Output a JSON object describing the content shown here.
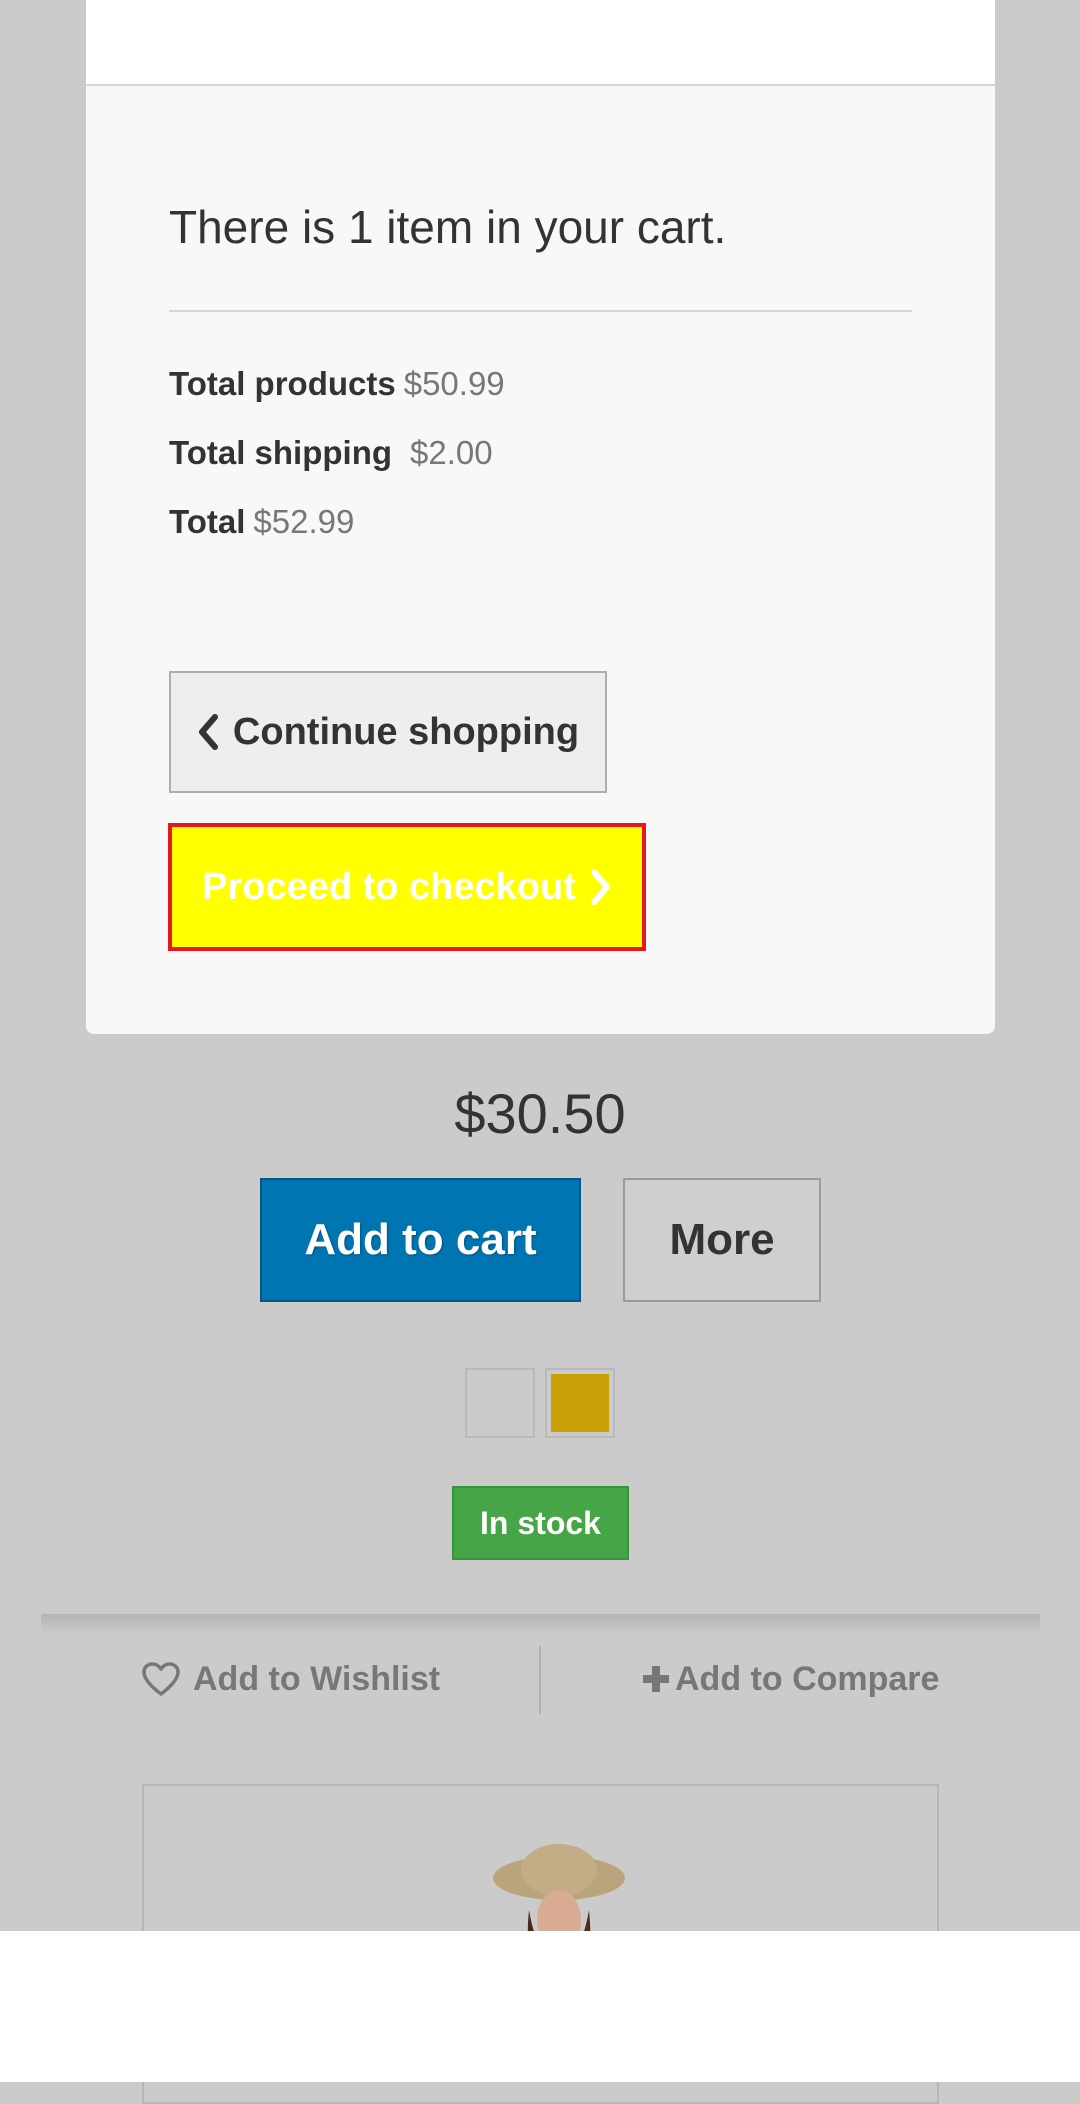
{
  "cart_popup": {
    "heading": "There is 1 item in your cart.",
    "summary": [
      {
        "label": "Total products",
        "value": "$50.99"
      },
      {
        "label": "Total shipping",
        "value": "$2.00"
      },
      {
        "label": "Total",
        "value": "$52.99"
      }
    ],
    "continue_label": "Continue shopping",
    "continue_icon": "chevron-left-icon",
    "checkout_label": "Proceed to checkout",
    "checkout_icon": "chevron-right-icon"
  },
  "product": {
    "price": "$30.50",
    "add_to_cart_label": "Add to cart",
    "more_label": "More",
    "color_swatches": [
      {
        "name": "white",
        "color": "#cbcbcb"
      },
      {
        "name": "gold",
        "color": "#c89f06"
      }
    ],
    "stock_label": "In stock",
    "wishlist_label": "Add to Wishlist",
    "wishlist_icon": "heart-icon",
    "compare_label": "Add to Compare",
    "compare_icon": "plus-icon"
  },
  "colors": {
    "checkout_bg": "#ffff00",
    "checkout_border": "#e5191c",
    "add_to_cart_bg": "#0075b2",
    "stock_bg": "#46a546"
  }
}
